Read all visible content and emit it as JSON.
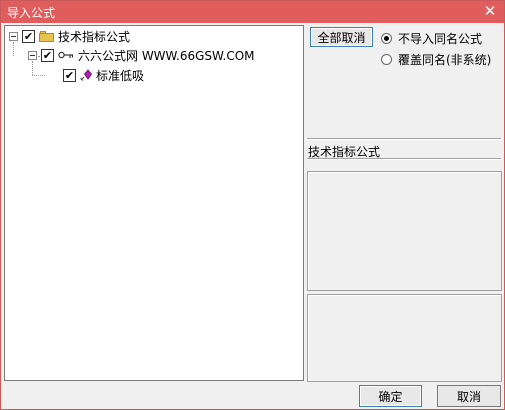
{
  "window": {
    "title": "导入公式",
    "close_glyph": "✕"
  },
  "tree": {
    "root": {
      "label": "技术指标公式",
      "checked": true,
      "icon": "folder-icon"
    },
    "group": {
      "label": "六六公式网 WWW.66GSW.COM",
      "checked": true,
      "icon": "key-icon"
    },
    "leaf": {
      "label": "标准低吸",
      "checked": true,
      "icon": "formula-icon"
    }
  },
  "controls": {
    "deselect_all_label": "全部取消",
    "option_skip_label": "不导入同名公式",
    "option_overwrite_label": "覆盖同名(非系统)",
    "selected_option": "skip"
  },
  "detail": {
    "formula_type_label": "技术指标公式"
  },
  "footer": {
    "ok_label": "确定",
    "cancel_label": "取消"
  },
  "colors": {
    "title_bar": "#e05d5d",
    "folder": "#e9c14e",
    "formula_icon": "#b01eb0"
  }
}
